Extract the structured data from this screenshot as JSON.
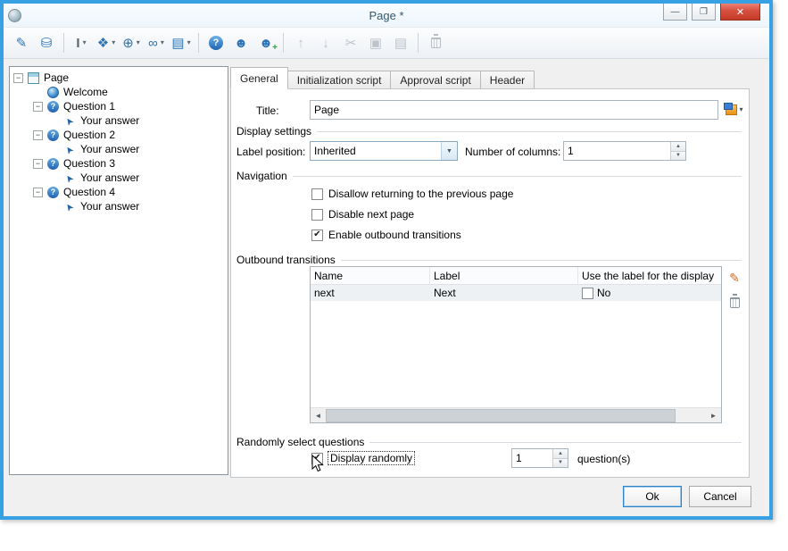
{
  "window": {
    "title": "Page *",
    "controls": {
      "minimize": "—",
      "maximize": "❐",
      "close": "✕"
    }
  },
  "glyphs": {
    "dropdown": "▾",
    "combo": "▼",
    "spin_up": "▲",
    "spin_down": "▼",
    "check": "✔",
    "minus": "−",
    "question": "?",
    "cursor": "➤",
    "scroll_left": "◄",
    "scroll_right": "►",
    "pencil": "✎"
  },
  "toolbar": {
    "items": [
      {
        "name": "edit-wand",
        "glyph": "✎"
      },
      {
        "name": "data-import",
        "glyph": "⛁"
      },
      {
        "name": "text-field",
        "glyph": "I"
      },
      {
        "name": "component",
        "glyph": "❖"
      },
      {
        "name": "globe",
        "glyph": "⊕"
      },
      {
        "name": "link",
        "glyph": "∞"
      },
      {
        "name": "layers",
        "glyph": "▤"
      },
      {
        "name": "help",
        "glyph": "?"
      },
      {
        "name": "user",
        "glyph": "☻"
      },
      {
        "name": "add-user",
        "glyph": "☻",
        "badge": "+"
      },
      {
        "name": "move-up",
        "glyph": "↑"
      },
      {
        "name": "move-down",
        "glyph": "↓"
      },
      {
        "name": "cut",
        "glyph": "✂"
      },
      {
        "name": "copy",
        "glyph": "▣"
      },
      {
        "name": "paste",
        "glyph": "▤"
      },
      {
        "name": "delete",
        "glyph": ""
      }
    ]
  },
  "tree": {
    "items": [
      {
        "label": "Page"
      },
      {
        "label": "Welcome"
      },
      {
        "label": "Question 1"
      },
      {
        "label": "Your answer"
      },
      {
        "label": "Question 2"
      },
      {
        "label": "Your answer"
      },
      {
        "label": "Question 3"
      },
      {
        "label": "Your answer"
      },
      {
        "label": "Question 4"
      },
      {
        "label": "Your answer"
      }
    ]
  },
  "tabs": {
    "items": [
      {
        "label": "General"
      },
      {
        "label": "Initialization script"
      },
      {
        "label": "Approval script"
      },
      {
        "label": "Header"
      }
    ]
  },
  "form": {
    "title": {
      "label": "Title:",
      "value": "Page"
    },
    "display": {
      "group_label": "Display settings",
      "label_position_label": "Label position:",
      "label_position_value": "Inherited",
      "columns_label": "Number of columns:",
      "columns_value": "1"
    },
    "navigation": {
      "group_label": "Navigation",
      "options": [
        {
          "label": "Disallow returning to the previous page",
          "checked": false
        },
        {
          "label": "Disable next page",
          "checked": false
        },
        {
          "label": "Enable outbound transitions",
          "checked": true
        }
      ]
    },
    "transitions": {
      "group_label": "Outbound transitions",
      "columns": [
        "Name",
        "Label",
        "Use the label for the display"
      ],
      "rows": [
        {
          "name": "next",
          "label": "Next",
          "use_label_text": "No",
          "use_label_checked": false
        }
      ]
    },
    "random": {
      "group_label": "Randomly select questions",
      "option_label": "Display randomly",
      "checked": true,
      "count": "1",
      "unit_label": "question(s)"
    }
  },
  "footer": {
    "ok_label": "Ok",
    "cancel_label": "Cancel"
  }
}
